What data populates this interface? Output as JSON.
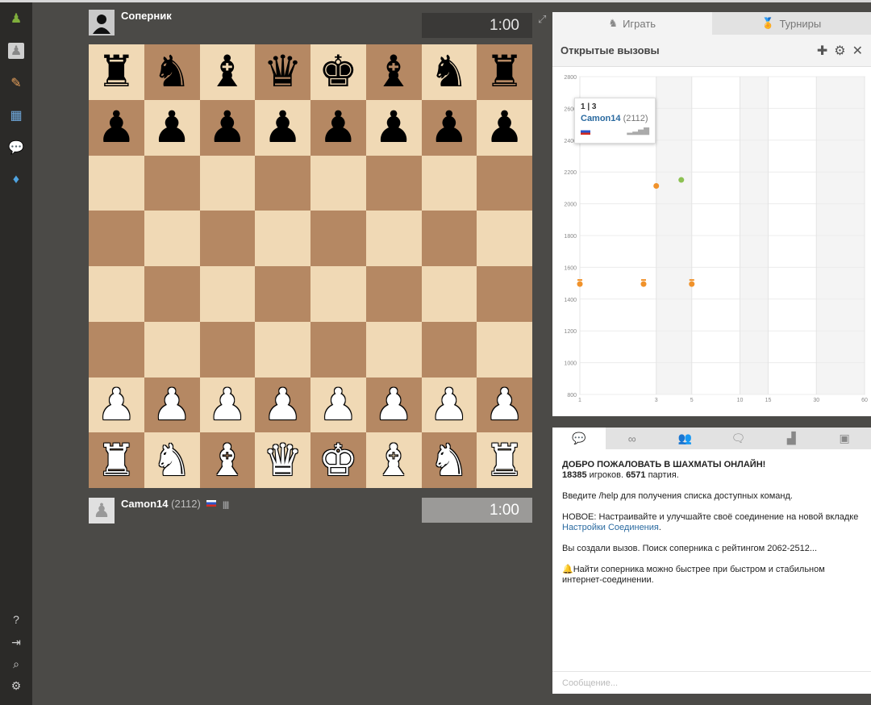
{
  "opponent": {
    "name": "Соперник",
    "clock": "1:00"
  },
  "player": {
    "name": "Camon14",
    "rating": "(2112)",
    "clock": "1:00"
  },
  "board": [
    [
      "♜",
      "♞",
      "♝",
      "♛",
      "♚",
      "♝",
      "♞",
      "♜"
    ],
    [
      "♟",
      "♟",
      "♟",
      "♟",
      "♟",
      "♟",
      "♟",
      "♟"
    ],
    [
      "",
      "",
      "",
      "",
      "",
      "",
      "",
      ""
    ],
    [
      "",
      "",
      "",
      "",
      "",
      "",
      "",
      ""
    ],
    [
      "",
      "",
      "",
      "",
      "",
      "",
      "",
      ""
    ],
    [
      "",
      "",
      "",
      "",
      "",
      "",
      "",
      ""
    ],
    [
      "♙",
      "♙",
      "♙",
      "♙",
      "♙",
      "♙",
      "♙",
      "♙"
    ],
    [
      "♖",
      "♘",
      "♗",
      "♕",
      "♔",
      "♗",
      "♘",
      "♖"
    ]
  ],
  "tabs": {
    "play": "Играть",
    "tournaments": "Турниры"
  },
  "panel": {
    "title": "Открытые вызовы"
  },
  "tooltip": {
    "count": "1 | 3",
    "name": "Camon14",
    "rating": "(2112)"
  },
  "graph": {
    "y_ticks": [
      "2800",
      "2600",
      "2400",
      "2200",
      "2000",
      "1800",
      "1600",
      "1400",
      "1200",
      "1000",
      "800"
    ],
    "x_ticks": [
      "1",
      "3",
      "5",
      "10",
      "15",
      "30",
      "60"
    ],
    "points": [
      {
        "x": 3,
        "y": 2112,
        "color": "#f0922b",
        "kind": "dot"
      },
      {
        "x": 4.3,
        "y": 2150,
        "color": "#8cc152",
        "kind": "dot"
      },
      {
        "x": 1,
        "y": 1500,
        "color": "#f0922b",
        "kind": "medal"
      },
      {
        "x": 2.5,
        "y": 1500,
        "color": "#f0922b",
        "kind": "medal"
      },
      {
        "x": 5,
        "y": 1500,
        "color": "#f0922b",
        "kind": "medal"
      }
    ]
  },
  "chat": {
    "welcome": "ДОБРО ПОЖАЛОВАТЬ В ШАХМАТЫ ОНЛАЙН!",
    "players_count": "18385",
    "players_text": " игроков. ",
    "games_count": "6571",
    "games_text": " партия.",
    "help_line": "Введите /help для получения списка доступных команд.",
    "new_line": "НОВОЕ: Настраивайте и улучшайте своё соединение на новой вкладке ",
    "settings_link": "Настройки Соединения",
    "seek_line": "Вы создали вызов. Поиск соперника с рейтингом 2062-2512...",
    "tip_line": "Найти соперника можно быстрее при быстром и стабильном интернет-соединении.",
    "placeholder": "Сообщение..."
  }
}
